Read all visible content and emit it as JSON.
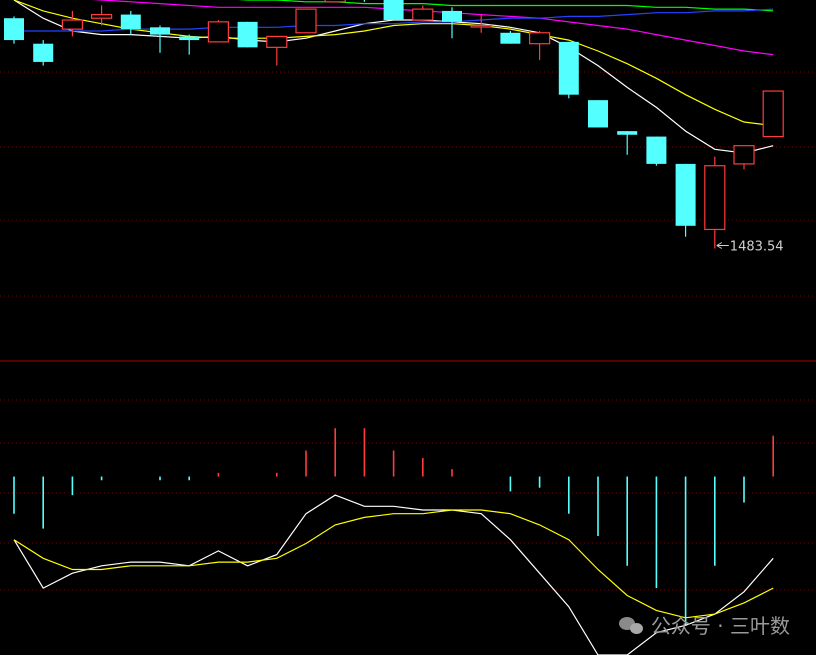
{
  "chart_data": [
    {
      "type": "candlestick",
      "title": "",
      "ylim": [
        1430,
        1620
      ],
      "low_annotation": {
        "bar": 24,
        "label": "1483.54"
      },
      "colors": {
        "up": "#ff3b3b",
        "down": "#54ffff",
        "ma5": "#ffffff",
        "ma10": "#ffff00",
        "ma20": "#ff00ff",
        "ma30": "#00ff00",
        "ma60": "#2244ff"
      },
      "candles": [
        {
          "o": 1610,
          "h": 1611,
          "l": 1596,
          "c": 1598
        },
        {
          "o": 1596,
          "h": 1598,
          "l": 1584,
          "c": 1586
        },
        {
          "o": 1604,
          "h": 1614,
          "l": 1600,
          "c": 1609
        },
        {
          "o": 1610,
          "h": 1617,
          "l": 1606,
          "c": 1612
        },
        {
          "o": 1612,
          "h": 1614,
          "l": 1601,
          "c": 1604
        },
        {
          "o": 1605,
          "h": 1606,
          "l": 1591,
          "c": 1601
        },
        {
          "o": 1600,
          "h": 1601,
          "l": 1590,
          "c": 1598
        },
        {
          "o": 1597,
          "h": 1609,
          "l": 1597,
          "c": 1608
        },
        {
          "o": 1608,
          "h": 1608,
          "l": 1594,
          "c": 1594
        },
        {
          "o": 1594,
          "h": 1600,
          "l": 1584,
          "c": 1600
        },
        {
          "o": 1602,
          "h": 1615,
          "l": 1602,
          "c": 1615
        },
        {
          "o": 1619,
          "h": 1626,
          "l": 1619,
          "c": 1621
        },
        {
          "o": 1622,
          "h": 1627,
          "l": 1619,
          "c": 1621
        },
        {
          "o": 1622,
          "h": 1622,
          "l": 1609,
          "c": 1609
        },
        {
          "o": 1609,
          "h": 1617,
          "l": 1609,
          "c": 1615
        },
        {
          "o": 1614,
          "h": 1616,
          "l": 1599,
          "c": 1608
        },
        {
          "o": 1606,
          "h": 1612,
          "l": 1602,
          "c": 1606
        },
        {
          "o": 1602,
          "h": 1603,
          "l": 1596,
          "c": 1596
        },
        {
          "o": 1596,
          "h": 1603,
          "l": 1587,
          "c": 1602
        },
        {
          "o": 1597,
          "h": 1597,
          "l": 1566,
          "c": 1568
        },
        {
          "o": 1565,
          "h": 1565,
          "l": 1550,
          "c": 1550
        },
        {
          "o": 1548,
          "h": 1548,
          "l": 1535,
          "c": 1546
        },
        {
          "o": 1545,
          "h": 1545,
          "l": 1529,
          "c": 1530
        },
        {
          "o": 1530,
          "h": 1530,
          "l": 1490,
          "c": 1496
        },
        {
          "o": 1494,
          "h": 1534,
          "l": 1483.54,
          "c": 1529
        },
        {
          "o": 1530,
          "h": 1540,
          "l": 1527,
          "c": 1540
        },
        {
          "o": 1545,
          "h": 1570,
          "l": 1545,
          "c": 1570
        }
      ],
      "ma_lines": [
        {
          "key": "ma5",
          "values": [
            1620,
            1610,
            1603,
            1601,
            1601,
            1600,
            1599,
            1600,
            1598,
            1597,
            1599,
            1603,
            1607,
            1609,
            1609,
            1608,
            1607,
            1605,
            1602,
            1594,
            1584,
            1572,
            1561,
            1548,
            1538,
            1536,
            1540
          ]
        },
        {
          "key": "ma10",
          "values": [
            1620,
            1614,
            1610,
            1607,
            1604,
            1602,
            1600,
            1599,
            1599,
            1599,
            1600,
            1601,
            1603,
            1606,
            1607,
            1607,
            1606,
            1604,
            1601,
            1598,
            1592,
            1585,
            1577,
            1568,
            1560,
            1553,
            1551
          ]
        },
        {
          "key": "ma20",
          "values": [
            1623,
            1622,
            1621,
            1620,
            1619,
            1618,
            1617,
            1616,
            1616,
            1616,
            1616,
            1616,
            1616,
            1615,
            1614,
            1613,
            1612,
            1611,
            1610,
            1608,
            1606,
            1604,
            1601,
            1598,
            1595,
            1592,
            1590
          ]
        },
        {
          "key": "ma30",
          "values": [
            1626,
            1625,
            1624,
            1623,
            1623,
            1622,
            1621,
            1621,
            1620,
            1620,
            1619,
            1619,
            1618,
            1618,
            1618,
            1617,
            1617,
            1617,
            1617,
            1617,
            1617,
            1617,
            1616,
            1616,
            1615,
            1615,
            1614
          ]
        },
        {
          "key": "ma60",
          "values": [
            1603,
            1603,
            1603,
            1603,
            1604,
            1604,
            1604,
            1605,
            1605,
            1605,
            1606,
            1606,
            1607,
            1607,
            1608,
            1608,
            1609,
            1610,
            1610,
            1611,
            1611,
            1612,
            1613,
            1613,
            1614,
            1614,
            1615
          ]
        }
      ]
    },
    {
      "type": "macd",
      "title": "",
      "ylim": [
        -48,
        30
      ],
      "histogram": [
        -10,
        -14,
        -5,
        -1,
        0,
        -1,
        -1,
        1,
        0,
        1,
        7,
        13,
        13,
        7,
        5,
        2,
        0,
        -4,
        -3,
        -10,
        -16,
        -24,
        -30,
        -40,
        -24,
        -7,
        11
      ],
      "dif": [
        -17,
        -30,
        -26,
        -24,
        -23,
        -23,
        -24,
        -20,
        -24,
        -21,
        -10,
        -5,
        -8,
        -8,
        -9,
        -9,
        -10,
        -17,
        -26,
        -35,
        -48,
        -48,
        -42,
        -40,
        -37,
        -31,
        -22
      ],
      "dea": [
        -17,
        -22,
        -25,
        -25,
        -24,
        -24,
        -24,
        -23,
        -23,
        -22,
        -18,
        -13,
        -11,
        -10,
        -10,
        -9,
        -9,
        -10,
        -13,
        -17,
        -25,
        -32,
        -36,
        -38,
        -37,
        -34,
        -30
      ],
      "colors": {
        "pos": "#ff3b3b",
        "neg": "#54ffff",
        "dif": "#ffffff",
        "dea": "#ffff00"
      }
    }
  ],
  "watermark": {
    "text": "公众号 · 三叶数",
    "icon": "wechat-icon"
  }
}
